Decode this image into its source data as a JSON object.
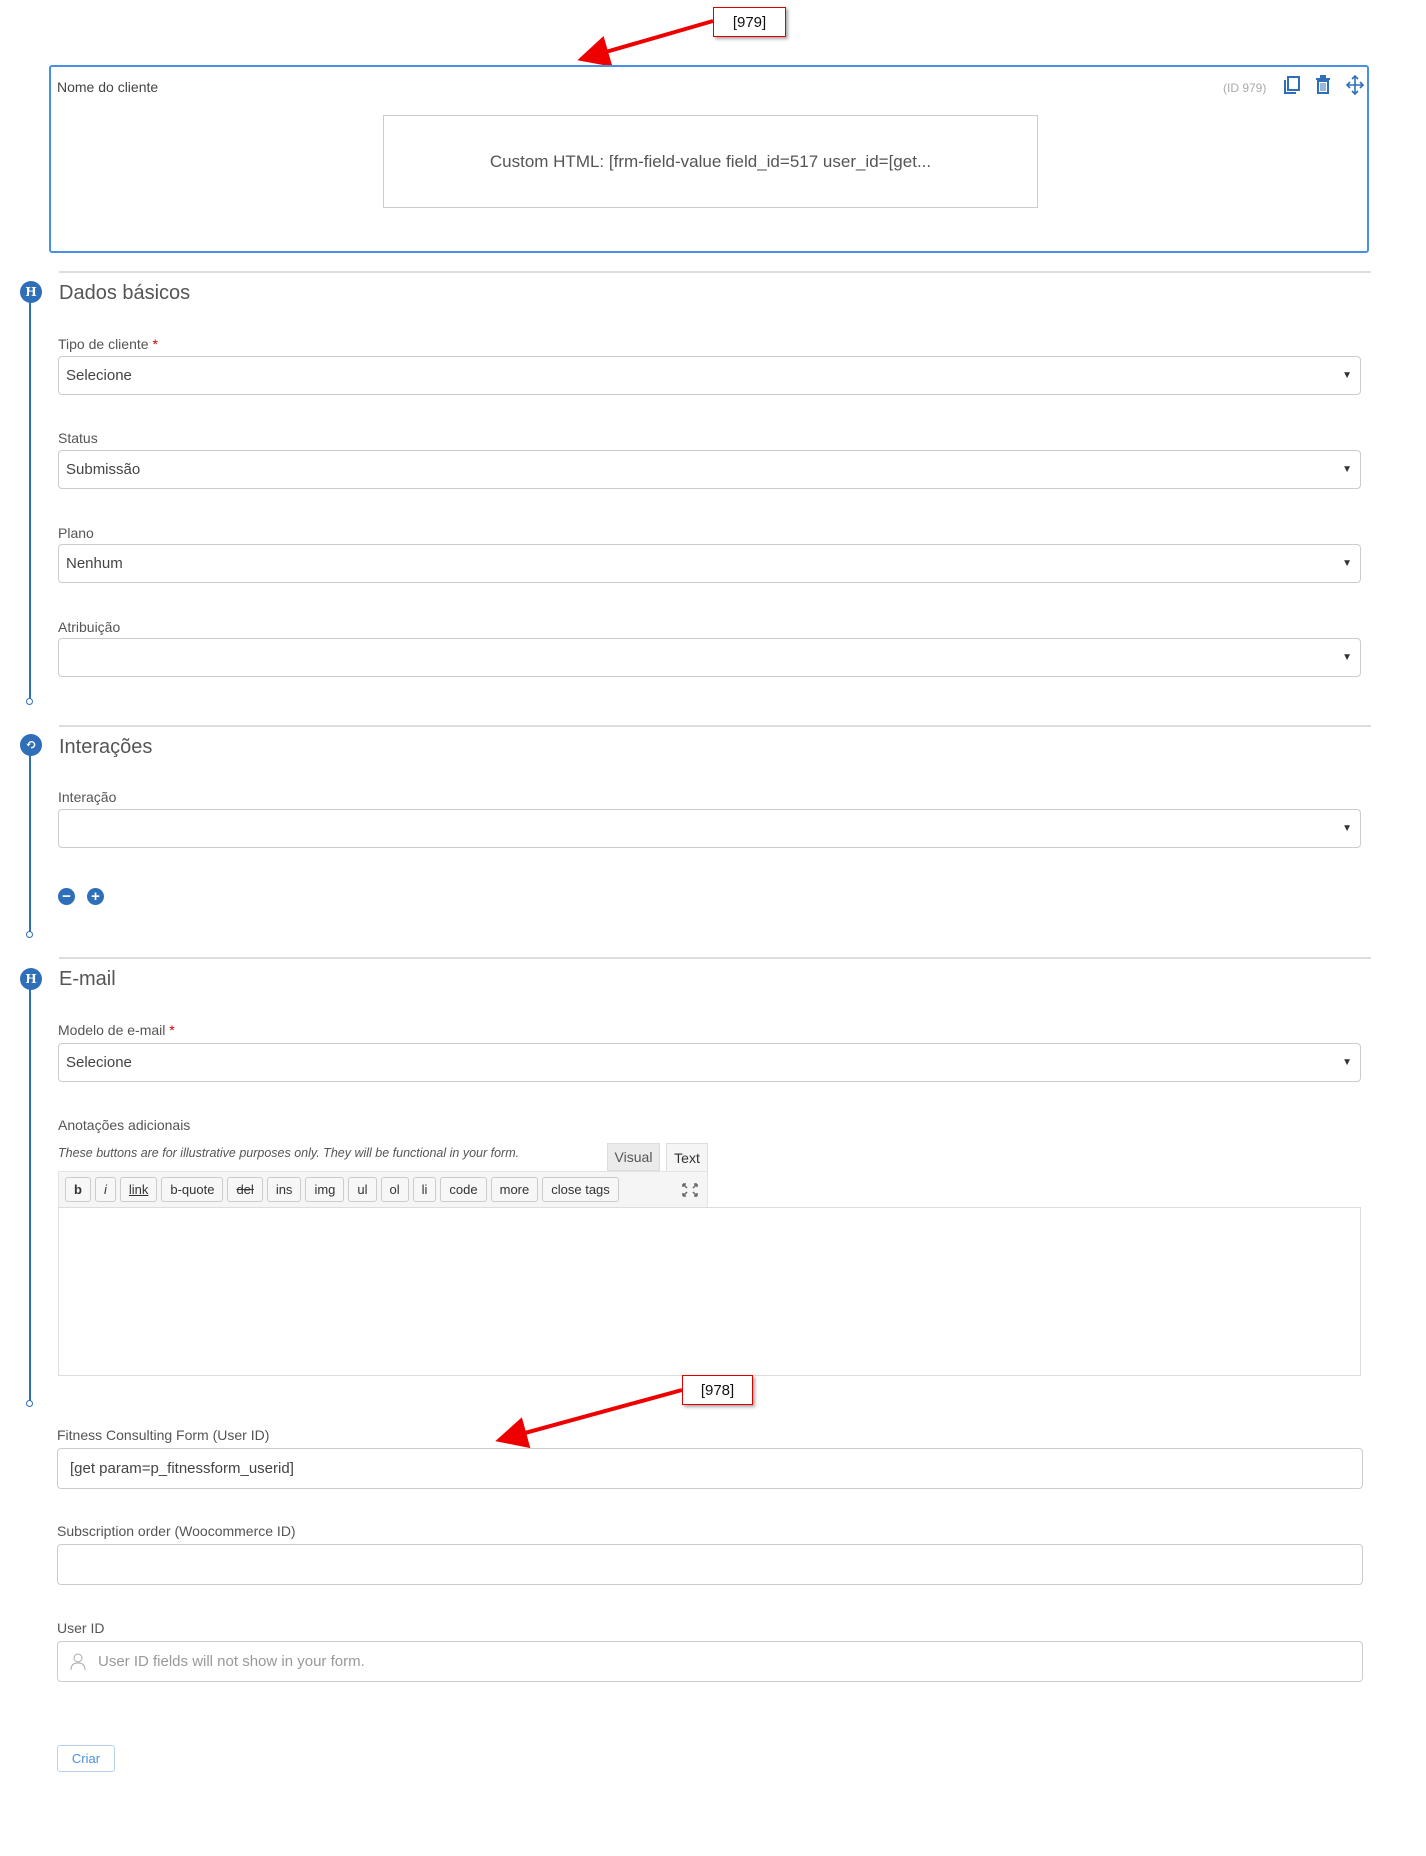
{
  "annotations": {
    "top": "[979]",
    "bottom": "[978]"
  },
  "custom_field": {
    "label": "Nome do cliente",
    "id_text": "(ID 979)",
    "preview": "Custom HTML: [frm-field-value field_id=517 user_id=[get..."
  },
  "sections": {
    "basic": {
      "title": "Dados básicos",
      "tipo": {
        "label": "Tipo de cliente",
        "required": "*",
        "value": "Selecione"
      },
      "status": {
        "label": "Status",
        "value": "Submissão"
      },
      "plano": {
        "label": "Plano",
        "value": "Nenhum"
      },
      "atribuicao": {
        "label": "Atribuição",
        "value": ""
      }
    },
    "interactions": {
      "title": "Interações",
      "interacao": {
        "label": "Interação",
        "value": ""
      }
    },
    "email": {
      "title": "E-mail",
      "modelo": {
        "label": "Modelo de e-mail",
        "required": "*",
        "value": "Selecione"
      },
      "notes": {
        "label": "Anotações adicionais",
        "hint": "These buttons are for illustrative purposes only. They will be functional in your form.",
        "tab_visual": "Visual",
        "tab_text": "Text",
        "buttons": [
          "b",
          "i",
          "link",
          "b-quote",
          "del",
          "ins",
          "img",
          "ul",
          "ol",
          "li",
          "code",
          "more",
          "close tags"
        ]
      }
    }
  },
  "fitness": {
    "label": "Fitness Consulting Form (User ID)",
    "value": "[get param=p_fitnessform_userid]"
  },
  "subscription": {
    "label": "Subscription order (Woocommerce ID)",
    "value": ""
  },
  "userid": {
    "label": "User ID",
    "placeholder": "User ID fields will not show in your form."
  },
  "submit": "Criar",
  "colors": {
    "accent": "#2f6fba",
    "selection": "#4a90e2",
    "callout": "#dd0000"
  }
}
